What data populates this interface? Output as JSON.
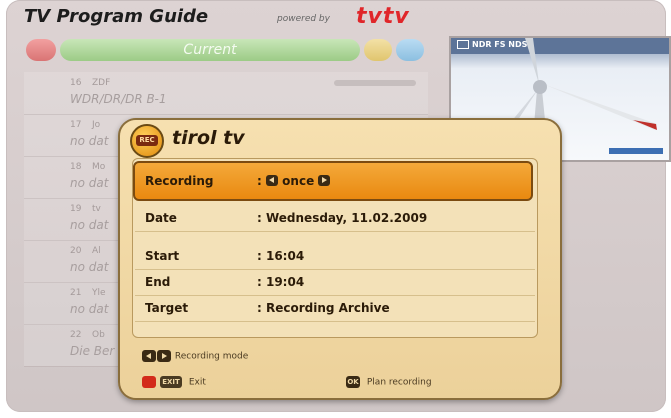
{
  "guide": {
    "title": "TV Program Guide",
    "powered_by": "powered by",
    "brand": "tvtv",
    "current_label": "Current",
    "preview_channel": "NDR FS NDS",
    "rows": [
      {
        "num": "16",
        "name": "ZDF",
        "sub": "WDR/DR/DR B-1"
      },
      {
        "num": "17",
        "name": "Jo",
        "sub": "no dat"
      },
      {
        "num": "18",
        "name": "Mo",
        "sub": "no dat"
      },
      {
        "num": "19",
        "name": "tv",
        "sub": "no dat"
      },
      {
        "num": "20",
        "name": "Al",
        "sub": "no dat"
      },
      {
        "num": "21",
        "name": "Yle",
        "sub": "no dat"
      },
      {
        "num": "22",
        "name": "Ob",
        "sub": "Die Ber"
      }
    ]
  },
  "dialog": {
    "badge": "REC",
    "channel_name": "tirol tv",
    "recording_label": "Recording",
    "recording_value": "once",
    "rows": [
      {
        "label": "Date",
        "value": ": Wednesday, 11.02.2009"
      },
      {
        "label": "Start",
        "value": ": 16:04"
      },
      {
        "label": "End",
        "value": ": 19:04"
      },
      {
        "label": "Target",
        "value": ": Recording Archive"
      }
    ],
    "legend": {
      "recording_mode": "Recording mode",
      "exit_key": "EXIT",
      "exit": "Exit",
      "ok_key": "OK",
      "plan_recording": "Plan recording"
    }
  },
  "colors": {
    "accent": "#e98910",
    "dialog_bg": "#f3e1b8",
    "brand_red": "#e0262a"
  }
}
